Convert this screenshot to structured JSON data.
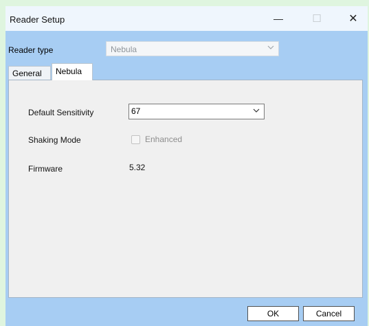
{
  "window": {
    "title": "Reader Setup",
    "minimize_glyph": "—",
    "maximize_glyph": "☐",
    "close_glyph": "✕"
  },
  "reader_type": {
    "label": "Reader type",
    "value": "Nebula",
    "chevron_icon": "chevron-down-icon"
  },
  "tabs": [
    {
      "label": "General",
      "selected": false
    },
    {
      "label": "Nebula",
      "selected": true
    }
  ],
  "nebula_tab": {
    "sensitivity_label": "Default Sensitivity",
    "sensitivity_value": "67",
    "shaking_label": "Shaking Mode",
    "shaking_option": "Enhanced",
    "shaking_checked": false,
    "firmware_label": "Firmware",
    "firmware_value": "5.32"
  },
  "buttons": {
    "ok": "OK",
    "cancel": "Cancel"
  },
  "colors": {
    "desktop": "#dff5df",
    "window_frame": "#a7cdf3",
    "titlebar": "#eff6fd",
    "panel": "#f0f0f0"
  }
}
